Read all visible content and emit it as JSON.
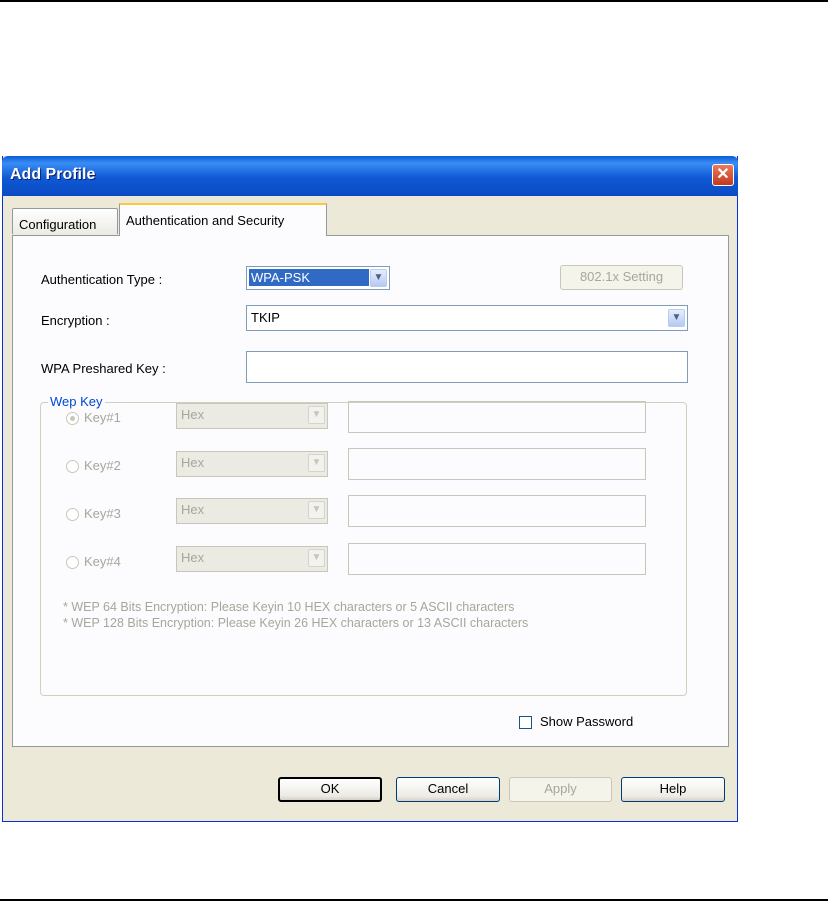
{
  "window": {
    "title": "Add Profile"
  },
  "tabs": [
    {
      "label": "Configuration"
    },
    {
      "label": "Authentication and Security"
    }
  ],
  "auth": {
    "type_label": "Authentication Type :",
    "type_value": "WPA-PSK",
    "setting_button": "802.1x Setting",
    "encryption_label": "Encryption :",
    "encryption_value": "TKIP",
    "psk_label": "WPA Preshared Key :",
    "psk_value": ""
  },
  "wep": {
    "group_label": "Wep Key",
    "keys": [
      {
        "label": "Key#1",
        "format": "Hex",
        "value": "",
        "selected": true
      },
      {
        "label": "Key#2",
        "format": "Hex",
        "value": "",
        "selected": false
      },
      {
        "label": "Key#3",
        "format": "Hex",
        "value": "",
        "selected": false
      },
      {
        "label": "Key#4",
        "format": "Hex",
        "value": "",
        "selected": false
      }
    ],
    "notes": [
      "* WEP 64 Bits Encryption:  Please Keyin 10 HEX characters or 5 ASCII characters",
      "* WEP 128 Bits Encryption:  Please Keyin 26 HEX characters or 13 ASCII characters"
    ]
  },
  "show_password_label": "Show Password",
  "buttons": {
    "ok": "OK",
    "cancel": "Cancel",
    "apply": "Apply",
    "help": "Help"
  },
  "colors": {
    "title_bar": "#0a5fd8",
    "selection": "#316ac5",
    "group_label": "#0046d5"
  }
}
